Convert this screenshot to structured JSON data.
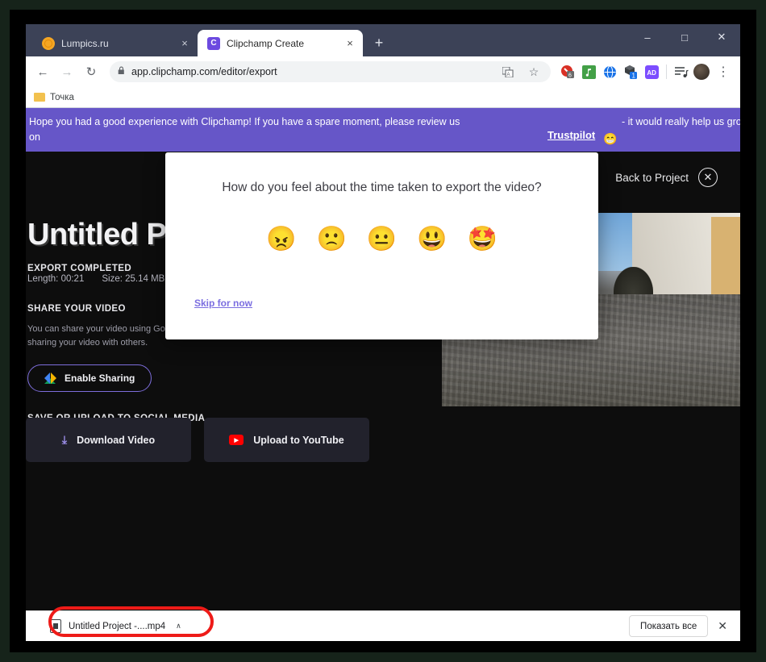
{
  "browser": {
    "tabs": [
      {
        "title": "Lumpics.ru",
        "favicon": "lumpics-favicon",
        "active": false,
        "close": "×"
      },
      {
        "title": "Clipchamp Create",
        "favicon": "clipchamp-favicon",
        "favicon_letter": "C",
        "active": true,
        "close": "×"
      }
    ],
    "new_tab_label": "+",
    "window_controls": {
      "minimize": "–",
      "maximize": "□",
      "close": "✕"
    },
    "nav": {
      "back": "←",
      "forward": "→",
      "reload": "↻"
    },
    "omnibox": {
      "lock_icon": "🔒",
      "url": "app.clipchamp.com/editor/export",
      "translate_icon": "translate-icon",
      "star_icon": "☆"
    },
    "toolbar_icons": [
      {
        "name": "adblock-extension-icon",
        "glyph": "⛔",
        "badge": "6"
      },
      {
        "name": "music-extension-icon",
        "glyph": "♫"
      },
      {
        "name": "globe-extension-icon",
        "glyph": "ἱ0"
      },
      {
        "name": "package-extension-icon",
        "glyph": "◰",
        "badge": "1"
      },
      {
        "name": "ad-extension-icon",
        "glyph": "AD"
      },
      {
        "name": "reading-list-icon",
        "glyph": "☰"
      }
    ],
    "menu_icon": "⋮",
    "bookmarks": [
      {
        "label": "Точка",
        "icon": "folder-icon"
      }
    ]
  },
  "promo": {
    "text_start": "Hope you had a good experience with Clipchamp! If you have a spare moment, please review us",
    "link": "Trustpilot",
    "emoji": "😁",
    "text_end": "- it would really help us grow",
    "text_wrap": "on",
    "bg_color": "#6656c8"
  },
  "app": {
    "back_label": "Back to Project",
    "close_icon": "✕",
    "project_title": "Untitled Project",
    "export_status": "EXPORT COMPLETED",
    "length_label": "Length: 00:21",
    "size_label": "Size: 25.14 MB",
    "share_heading": "SHARE YOUR VIDEO",
    "share_desc_line1": "You can share your video using Goog",
    "share_desc_line2": "sharing your video with others.",
    "enable_sharing": "Enable Sharing",
    "social_heading": "SAVE OR UPLOAD TO SOCIAL MEDIA",
    "download_button": "Download Video",
    "download_icon": "⤓",
    "youtube_button": "Upload to YouTube",
    "youtube_icon": "▶",
    "accent_color": "#7d6ddb"
  },
  "modal": {
    "question": "How do you feel about the time taken to export the video?",
    "ratings": [
      {
        "name": "rating-angry",
        "glyph": "😠",
        "value": 1
      },
      {
        "name": "rating-frowning",
        "glyph": "🙁",
        "value": 2
      },
      {
        "name": "rating-neutral",
        "glyph": "😐",
        "value": 3
      },
      {
        "name": "rating-grinning",
        "glyph": "😃",
        "value": 4
      },
      {
        "name": "rating-star-struck",
        "glyph": "🤩",
        "value": 5
      }
    ],
    "skip_label": "Skip for now"
  },
  "download_bar": {
    "file_name": "Untitled Project -....mp4",
    "caret": "∧",
    "show_all": "Показать все",
    "close": "✕",
    "highlight_color": "#ee1b18"
  }
}
